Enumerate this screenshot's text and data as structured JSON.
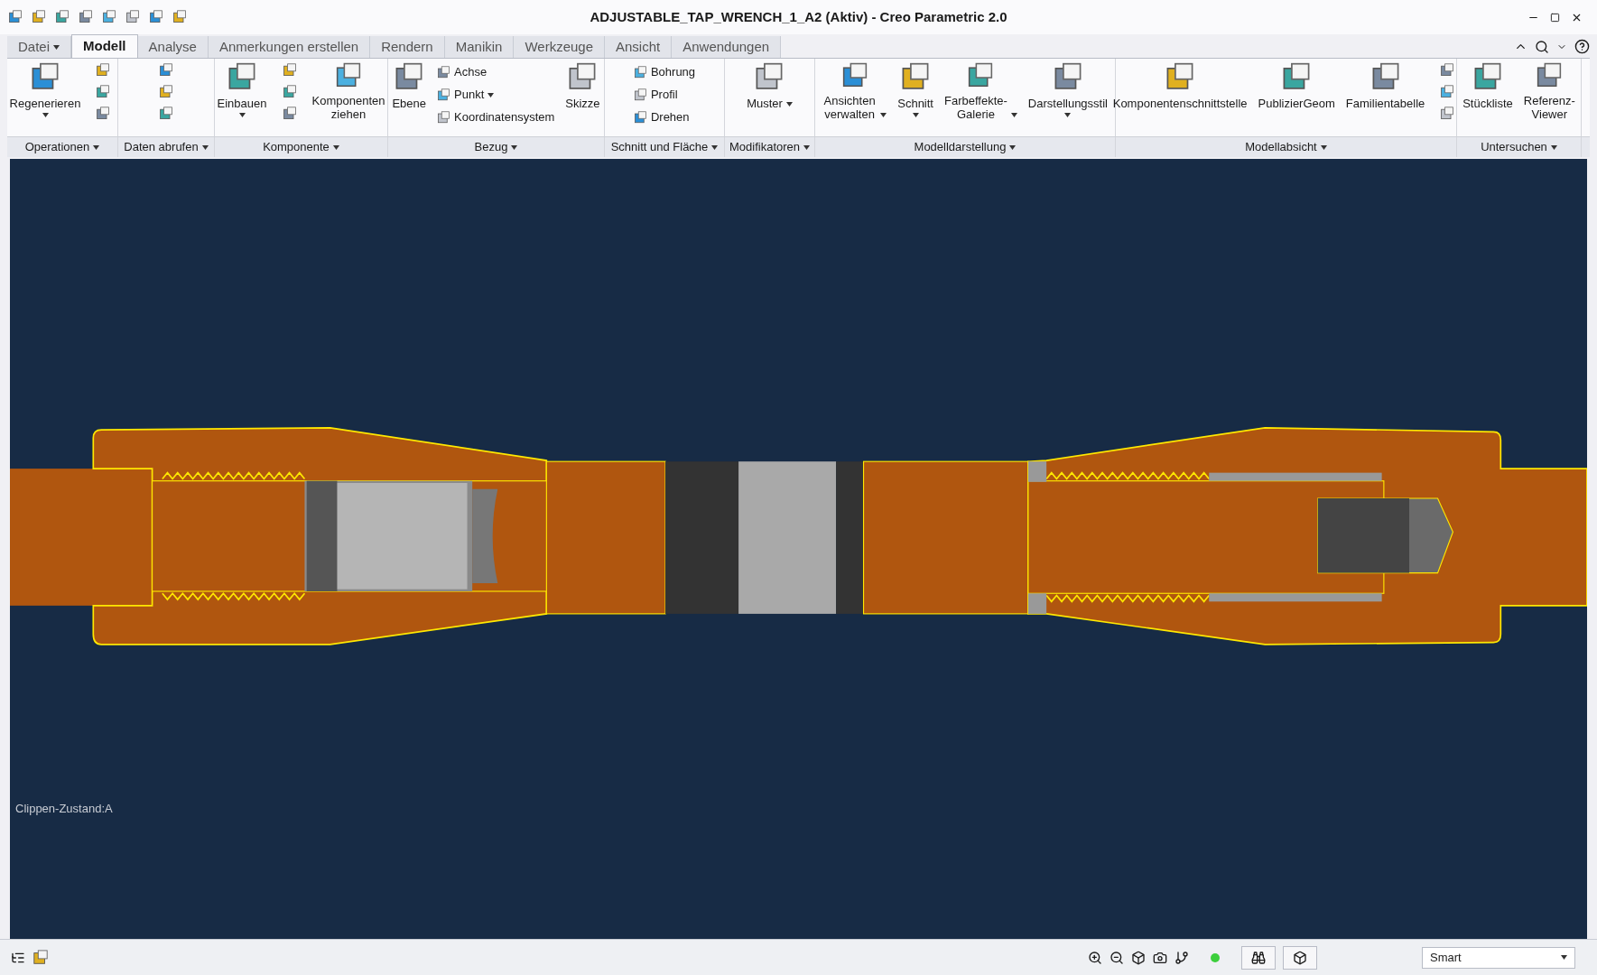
{
  "window": {
    "title": "ADJUSTABLE_TAP_WRENCH_1_A2 (Aktiv) - Creo Parametric 2.0"
  },
  "tabs": [
    {
      "label": "Datei",
      "kind": "menu",
      "selected": false
    },
    {
      "label": "Modell",
      "kind": "tab",
      "selected": true
    },
    {
      "label": "Analyse",
      "kind": "tab",
      "selected": false
    },
    {
      "label": "Anmerkungen erstellen",
      "kind": "tab",
      "selected": false
    },
    {
      "label": "Rendern",
      "kind": "tab",
      "selected": false
    },
    {
      "label": "Manikin",
      "kind": "tab",
      "selected": false
    },
    {
      "label": "Werkzeuge",
      "kind": "tab",
      "selected": false
    },
    {
      "label": "Ansicht",
      "kind": "tab",
      "selected": false
    },
    {
      "label": "Anwendungen",
      "kind": "tab",
      "selected": false
    }
  ],
  "ribbon_groups": [
    {
      "label": "Operationen",
      "columns": [
        {
          "kind": "large",
          "label": "Regenerieren",
          "menu_below": true
        },
        {
          "kind": "icons"
        }
      ]
    },
    {
      "label": "Daten abrufen",
      "columns": [
        {
          "kind": "icons"
        }
      ]
    },
    {
      "label": "Komponente",
      "columns": [
        {
          "kind": "large",
          "label": "Einbauen",
          "menu_below": true
        },
        {
          "kind": "icons"
        },
        {
          "kind": "large",
          "label": "Komponenten ziehen"
        }
      ]
    },
    {
      "label": "Bezug",
      "columns": [
        {
          "kind": "large",
          "label": "Ebene"
        },
        {
          "kind": "stack",
          "items": [
            {
              "label": "Achse"
            },
            {
              "label": "Punkt",
              "menu_inline": true
            },
            {
              "label": "Koordinatensystem"
            }
          ]
        },
        {
          "kind": "large",
          "label": "Skizze"
        }
      ]
    },
    {
      "label": "Schnitt und Fläche",
      "columns": [
        {
          "kind": "stack",
          "items": [
            {
              "label": "Bohrung"
            },
            {
              "label": "Profil"
            },
            {
              "label": "Drehen"
            }
          ]
        }
      ]
    },
    {
      "label": "Modifikatoren",
      "columns": [
        {
          "kind": "large",
          "label": "Muster",
          "menu_inline": true
        }
      ]
    },
    {
      "label": "Modelldarstellung",
      "columns": [
        {
          "kind": "large",
          "label": "Ansichten verwalten",
          "menu_inline": true
        },
        {
          "kind": "large",
          "label": "Schnitt",
          "menu_below": true
        },
        {
          "kind": "large",
          "label": "Farbeffekte-Galerie",
          "menu_inline": true
        },
        {
          "kind": "large",
          "label": "Darstellungsstil",
          "menu_below": true
        }
      ]
    },
    {
      "label": "Modellabsicht",
      "columns": [
        {
          "kind": "large",
          "label": "Komponentenschnittstelle"
        },
        {
          "kind": "large",
          "label": "PublizierGeom"
        },
        {
          "kind": "large",
          "label": "Familientabelle"
        },
        {
          "kind": "icons"
        }
      ]
    },
    {
      "label": "Untersuchen",
      "columns": [
        {
          "kind": "large",
          "label": "Stückliste"
        },
        {
          "kind": "large",
          "label": "Referenz-Viewer"
        }
      ]
    }
  ],
  "viewport": {
    "clip_state": "Clippen-Zustand:A"
  },
  "status_bar": {
    "selection_filter": "Smart"
  }
}
